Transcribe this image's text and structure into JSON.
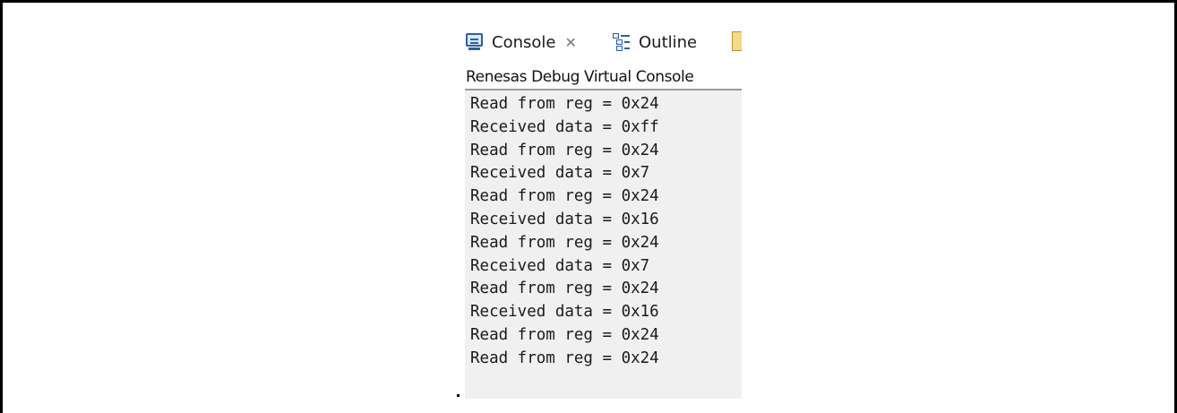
{
  "tabs": [
    {
      "label": "Console",
      "icon": "console-icon",
      "close": "✕",
      "active": true
    },
    {
      "label": "Outline",
      "icon": "outline-icon"
    }
  ],
  "console": {
    "title": "Renesas Debug Virtual Console",
    "lines": [
      "Read from reg = 0x24",
      "Received data = 0xff",
      "Read from reg = 0x24",
      "Received data = 0x7",
      "Read from reg = 0x24",
      "Received data = 0x16",
      "Read from reg = 0x24",
      "Received data = 0x7",
      "Read from reg = 0x24",
      "Received data = 0x16",
      "Read from reg = 0x24",
      "Read from reg = 0x24"
    ]
  },
  "colors": {
    "console_bg": "#f0f0f0",
    "icon_blue": "#2f5fa0",
    "frame": "#000000"
  }
}
